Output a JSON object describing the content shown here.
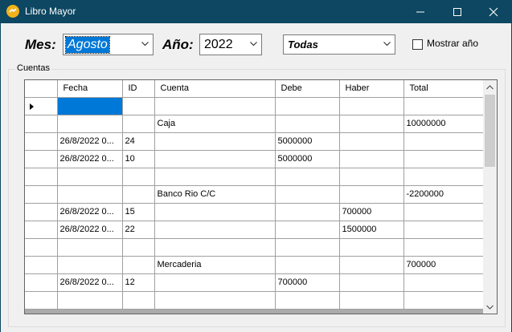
{
  "window": {
    "title": "Libro Mayor"
  },
  "filters": {
    "mes_label": "Mes:",
    "mes_value": "Agosto",
    "anio_label": "Año:",
    "anio_value": "2022",
    "cuenta_value": "Todas",
    "mostrar_anio_label": "Mostrar año",
    "mostrar_anio_checked": false
  },
  "group": {
    "title": "Cuentas"
  },
  "grid": {
    "columns": [
      "Fecha",
      "ID",
      "Cuenta",
      "Debe",
      "Haber",
      "Total"
    ],
    "rows": [
      [
        "",
        "",
        "",
        "",
        "",
        ""
      ],
      [
        "",
        "",
        "Caja",
        "",
        "",
        "10000000"
      ],
      [
        "26/8/2022 0...",
        "24",
        "",
        "5000000",
        "",
        ""
      ],
      [
        "26/8/2022 0...",
        "10",
        "",
        "5000000",
        "",
        ""
      ],
      [
        "",
        "",
        "",
        "",
        "",
        ""
      ],
      [
        "",
        "",
        "Banco Rio C/C",
        "",
        "",
        "-2200000"
      ],
      [
        "26/8/2022 0...",
        "15",
        "",
        "",
        "700000",
        ""
      ],
      [
        "26/8/2022 0...",
        "22",
        "",
        "",
        "1500000",
        ""
      ],
      [
        "",
        "",
        "",
        "",
        "",
        ""
      ],
      [
        "",
        "",
        "Mercaderia",
        "",
        "",
        "700000"
      ],
      [
        "26/8/2022 0...",
        "12",
        "",
        "700000",
        "",
        ""
      ],
      [
        "",
        "",
        "",
        "",
        "",
        ""
      ]
    ]
  },
  "colors": {
    "titlebar": "#0d4762",
    "selection": "#0078d7"
  }
}
